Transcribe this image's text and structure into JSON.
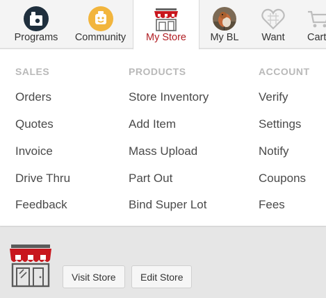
{
  "nav": {
    "items": [
      {
        "label": "Programs",
        "icon": "programs-icon"
      },
      {
        "label": "Community",
        "icon": "community-icon"
      },
      {
        "label": "My Store",
        "icon": "store-icon",
        "active": true
      },
      {
        "label": "My BL",
        "icon": "avatar"
      },
      {
        "label": "Want",
        "icon": "heart-icon"
      },
      {
        "label": "Cart",
        "icon": "cart-icon"
      }
    ]
  },
  "menu": {
    "sales": {
      "heading": "SALES",
      "links": [
        "Orders",
        "Quotes",
        "Invoice",
        "Drive Thru",
        "Feedback"
      ]
    },
    "products": {
      "heading": "PRODUCTS",
      "links": [
        "Store Inventory",
        "Add Item",
        "Mass Upload",
        "Part Out",
        "Bind Super Lot"
      ]
    },
    "account": {
      "heading": "ACCOUNT",
      "links": [
        "Verify",
        "Settings",
        "Notify",
        "Coupons",
        "Fees"
      ]
    }
  },
  "store": {
    "visit_label": "Visit Store",
    "edit_label": "Edit Store",
    "icon": "storefront-icon"
  },
  "colors": {
    "accent": "#b01e23",
    "awning_red": "#c8161d",
    "programs_circle": "#1f2f3d",
    "community_circle": "#f2b53d"
  }
}
